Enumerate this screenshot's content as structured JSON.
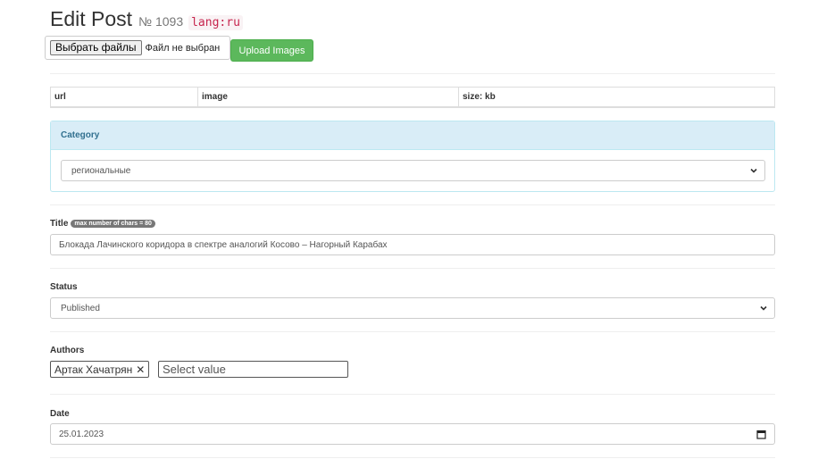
{
  "heading": {
    "title": "Edit Post",
    "number": "№ 1093",
    "lang": "lang:ru"
  },
  "upload": {
    "choose_files_label": "Выбрать файлы",
    "no_file_text": "Файл не выбран",
    "upload_button_label": "Upload Images"
  },
  "files_table": {
    "columns": [
      "url",
      "image",
      "size: kb"
    ]
  },
  "category": {
    "heading": "Category",
    "selected": "региональные"
  },
  "title_field": {
    "label": "Title",
    "badge": "max number of chars = 80",
    "value": "Блокада Лачинского коридора в спектре аналогий Косово – Нагорный Карабах"
  },
  "status_field": {
    "label": "Status",
    "selected": "Published"
  },
  "authors_field": {
    "label": "Authors",
    "selected_tags": [
      "Артак Хачатрян"
    ],
    "remove_glyph": "✕",
    "placeholder": "Select value"
  },
  "date_field": {
    "label": "Date",
    "value": "25.01.2023"
  },
  "colors": {
    "upload_button": "#5cb85c",
    "panel_heading_bg": "#d9edf7",
    "panel_heading_text": "#31708f",
    "badge_bg": "#777777",
    "lang_code": "#c7254e"
  }
}
